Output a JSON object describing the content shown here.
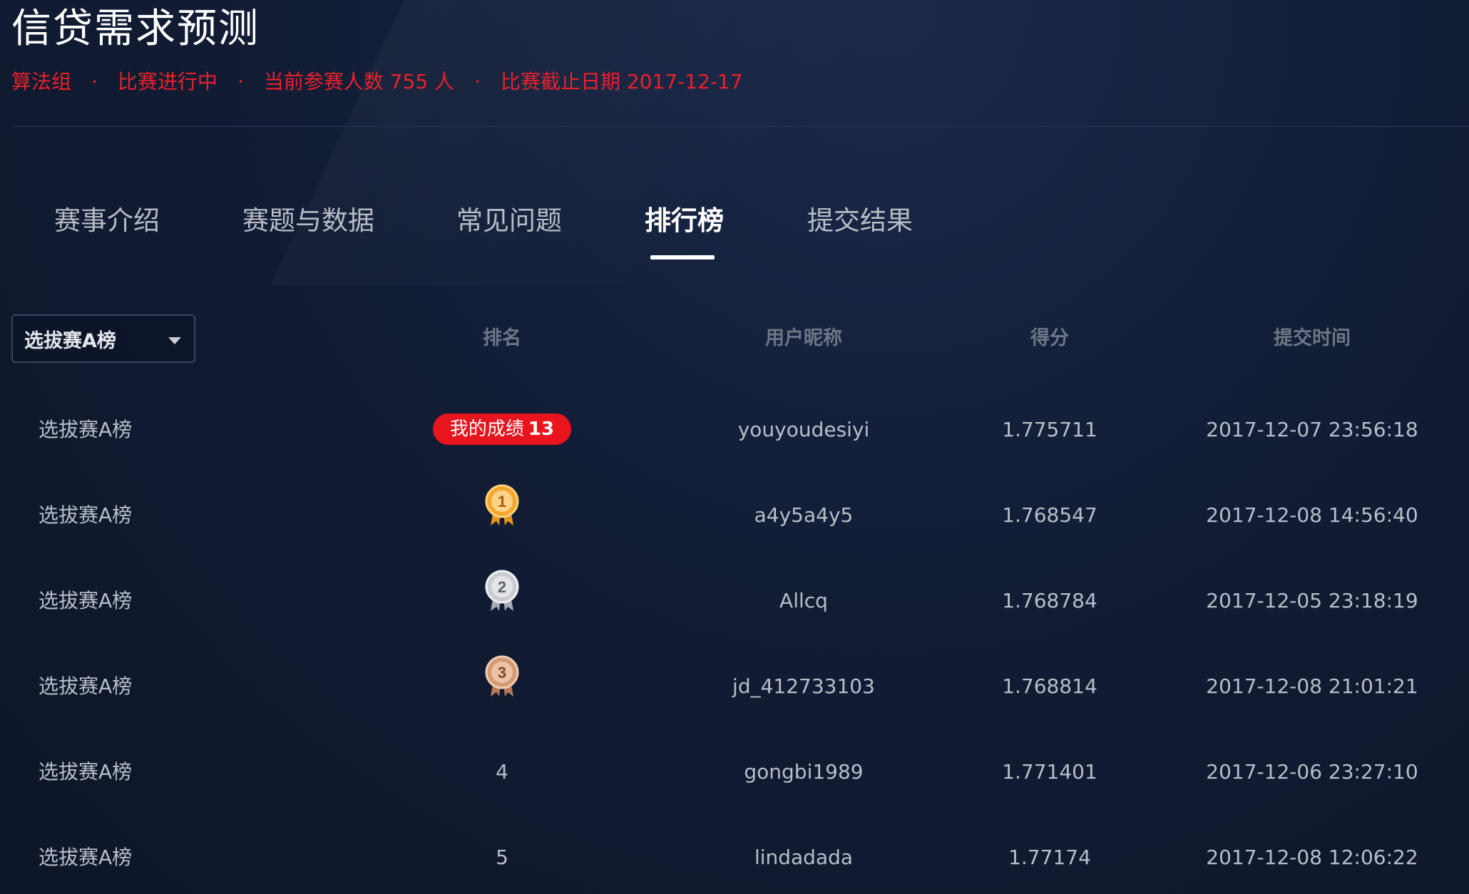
{
  "header": {
    "title": "信贷需求预测",
    "meta": {
      "group": "算法组",
      "status": "比赛进行中",
      "participants": "当前参赛人数 755 人",
      "deadline": "比赛截止日期 2017-12-17",
      "separator": "·"
    }
  },
  "tabs": [
    {
      "label": "赛事介绍",
      "active": false
    },
    {
      "label": "赛题与数据",
      "active": false
    },
    {
      "label": "常见问题",
      "active": false
    },
    {
      "label": "排行榜",
      "active": true
    },
    {
      "label": "提交结果",
      "active": false
    }
  ],
  "board_select": {
    "selected": "选拔赛A榜"
  },
  "table": {
    "headers": {
      "rank": "排名",
      "user": "用户昵称",
      "score": "得分",
      "time": "提交时间"
    },
    "my_result": {
      "board": "选拔赛A榜",
      "badge_label": "我的成绩",
      "rank": "13",
      "user": "youyoudesiyi",
      "score": "1.775711",
      "time": "2017-12-07 23:56:18"
    },
    "rows": [
      {
        "board": "选拔赛A榜",
        "rank": "1",
        "medal": "gold",
        "user": "a4y5a4y5",
        "score": "1.768547",
        "time": "2017-12-08 14:56:40"
      },
      {
        "board": "选拔赛A榜",
        "rank": "2",
        "medal": "silver",
        "user": "Allcq",
        "score": "1.768784",
        "time": "2017-12-05 23:18:19"
      },
      {
        "board": "选拔赛A榜",
        "rank": "3",
        "medal": "bronze",
        "user": "jd_412733103",
        "score": "1.768814",
        "time": "2017-12-08 21:01:21"
      },
      {
        "board": "选拔赛A榜",
        "rank": "4",
        "medal": "",
        "user": "gongbi1989",
        "score": "1.771401",
        "time": "2017-12-06 23:27:10"
      },
      {
        "board": "选拔赛A榜",
        "rank": "5",
        "medal": "",
        "user": "lindadada",
        "score": "1.77174",
        "time": "2017-12-08 12:06:22"
      }
    ]
  },
  "colors": {
    "accent_red": "#e8141e",
    "meta_red": "#e8212d",
    "gold": "#f3a72e",
    "silver": "#c9ccd2",
    "bronze": "#d49a74"
  }
}
